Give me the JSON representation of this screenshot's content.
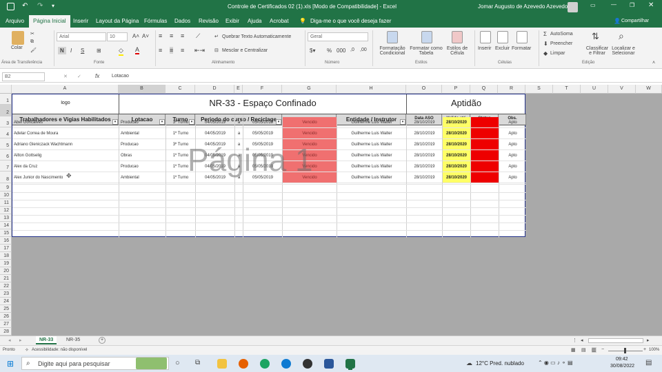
{
  "titlebar": {
    "title": "Controle de Certificados 02 (1).xls  [Modo de Compatibilidade]  -  Excel",
    "user": "Jomar Augusto de Azevedo Azevedo"
  },
  "menu": {
    "items": [
      "Arquivo",
      "Página Inicial",
      "Inserir",
      "Layout da Página",
      "Fórmulas",
      "Dados",
      "Revisão",
      "Exibir",
      "Ajuda",
      "Acrobat"
    ],
    "tellme": "Diga-me o que você deseja fazer",
    "share": "Compartilhar"
  },
  "ribbon": {
    "colar": "Colar",
    "font_name": "Arial",
    "font_size": "10",
    "wrap": "Quebrar Texto Automaticamente",
    "merge": "Mesclar e Centralizar",
    "number_format": "Geral",
    "cond_fmt": "Formatação Condicional",
    "fmt_table": "Formatar como Tabela",
    "cell_styles": "Estilos de Célula",
    "insert": "Inserir",
    "delete": "Excluir",
    "format": "Formatar",
    "autosum": "AutoSoma",
    "fill": "Preencher",
    "clear": "Limpar",
    "sort": "Classificar e Filtrar",
    "find": "Localizar e Selecionar",
    "groups": [
      "Área de Transferência",
      "Fonte",
      "Alinhamento",
      "Número",
      "Estilos",
      "Células",
      "Edição"
    ]
  },
  "formula": {
    "name_box": "B2",
    "fx": "fx",
    "value": "Lotacao"
  },
  "columns": [
    "A",
    "B",
    "C",
    "D",
    "E",
    "F",
    "G",
    "H",
    "O",
    "P",
    "Q",
    "R",
    "S",
    "T",
    "U",
    "V",
    "W"
  ],
  "rows": [
    "1",
    "2",
    "3",
    "4",
    "5",
    "6",
    "7",
    "8",
    "9",
    "10",
    "11",
    "12",
    "13",
    "14",
    "15",
    "16",
    "17",
    "18",
    "19",
    "20",
    "21",
    "22",
    "23",
    "24",
    "25",
    "26",
    "27",
    "28"
  ],
  "sheet": {
    "logo": "logo",
    "title": "NR-33 - Espaço Confinado",
    "aptidao": "Aptidão",
    "watermark": "Página 1",
    "headers": [
      "Trabalhadores e Vigias Habilitados",
      "Lotacao",
      "Turno",
      "Periodo do curso / Reciclage",
      "Validade",
      "Entidade / Instrutor",
      "Data ASO",
      "Valido até",
      "Status",
      "Obs."
    ],
    "records": [
      [
        "Abel Goncalves",
        "Producao",
        "3º Turno",
        "04/05/2019",
        "a",
        "05/05/2019",
        "Vencido",
        "Guilherme Luis Walter",
        "28/10/2019",
        "28/10/2020",
        "",
        "Apto"
      ],
      [
        "Adelar Correa de Moura",
        "Ambiental",
        "1º Turno",
        "04/05/2019",
        "a",
        "05/05/2019",
        "Vencido",
        "Guilherme Luis Walter",
        "28/10/2019",
        "28/10/2020",
        "",
        "Apto"
      ],
      [
        "Adriano Gleniczack Wachtmann",
        "Producao",
        "3º Turno",
        "04/05/2019",
        "a",
        "05/05/2019",
        "Vencido",
        "Guilherme Luis Walter",
        "28/10/2019",
        "28/10/2020",
        "",
        "Apto"
      ],
      [
        "Ailton Gottselig",
        "Obras",
        "1º Turno",
        "04/05/2019",
        "a",
        "05/05/2019",
        "Vencido",
        "Guilherme Luis Walter",
        "28/10/2019",
        "28/10/2020",
        "",
        "Apto"
      ],
      [
        "Alex da Cruz",
        "Producao",
        "1º Turno",
        "04/05/2019",
        "a",
        "05/05/2019",
        "Vencido",
        "Guilherme Luis Walter",
        "28/10/2019",
        "28/10/2020",
        "",
        "Apto"
      ],
      [
        "Alex Junior do Nascimento",
        "Ambiental",
        "1º Turno",
        "04/05/2019",
        "a",
        "05/05/2019",
        "Vencido",
        "Guilherme Luis Walter",
        "28/10/2019",
        "28/10/2020",
        "",
        "Apto"
      ]
    ]
  },
  "tabs": [
    "NR-33",
    "NR-35"
  ],
  "status": {
    "ready": "Pronto",
    "accessibility": "Acessibilidade: não disponível",
    "zoom": "100%"
  },
  "taskbar": {
    "search": "Digite aqui para pesquisar",
    "weather": "12°C  Pred. nublado",
    "time": "09:42",
    "date": "30/08/2022"
  },
  "colors": {
    "excel_green": "#217346",
    "vencido": "#f07070",
    "valido": "#ffff66",
    "status_red": "#ee0000"
  }
}
